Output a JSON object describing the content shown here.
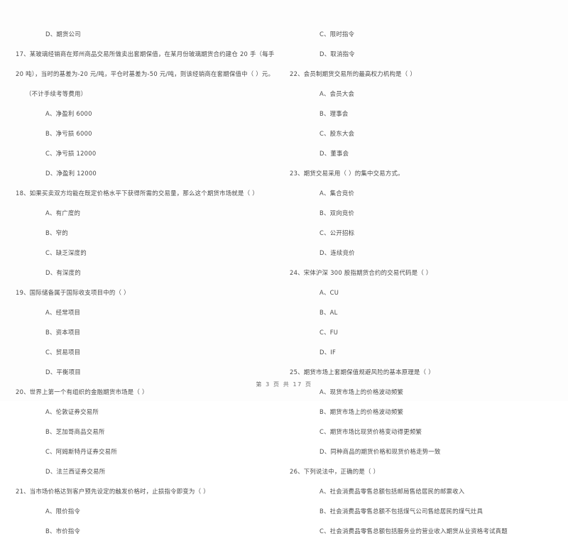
{
  "document": {
    "type": "exam-paper",
    "footer": "第 3 页  共 17 页"
  },
  "left_column": {
    "blocks": [
      {
        "kind": "option",
        "text": "D、期货公司"
      },
      {
        "kind": "question",
        "text": "17、某玻璃经销商在郑州商品交易所做卖出套期保值，在某月份玻璃期货合约建仓 20 手（每手"
      },
      {
        "kind": "question_cont",
        "text": "20 吨），当时的基差为-20 元/吨，平仓时基差为-50 元/吨，则该经销商在套期保值中（      ）元。"
      },
      {
        "kind": "question_cont2",
        "text": "（不计手续考等费用）"
      },
      {
        "kind": "option",
        "text": "A、净盈利 6000"
      },
      {
        "kind": "option",
        "text": "B、净亏损 6000"
      },
      {
        "kind": "option",
        "text": "C、净亏损 12000"
      },
      {
        "kind": "option",
        "text": "D、净盈利 12000"
      },
      {
        "kind": "question",
        "text": "18、如果买卖双方均能在既定价格水平下获得所需的交易量，那么这个期货市场就是（      ）"
      },
      {
        "kind": "option",
        "text": "A、有广度的"
      },
      {
        "kind": "option",
        "text": "B、窄的"
      },
      {
        "kind": "option",
        "text": "C、缺乏深度的"
      },
      {
        "kind": "option",
        "text": "D、有深度的"
      },
      {
        "kind": "question",
        "text": "19、国际储备属于国际收支项目中的（      ）"
      },
      {
        "kind": "option",
        "text": "A、经常项目"
      },
      {
        "kind": "option",
        "text": "B、资本项目"
      },
      {
        "kind": "option",
        "text": "C、贸易项目"
      },
      {
        "kind": "option",
        "text": "D、平衡项目"
      },
      {
        "kind": "question",
        "text": "20、世界上第一个有组织的金融期货市场是（      ）"
      },
      {
        "kind": "option",
        "text": "A、伦敦证券交易所"
      },
      {
        "kind": "option",
        "text": "B、芝加哥商品交易所"
      },
      {
        "kind": "option",
        "text": "C、阿姆斯特丹证券交易所"
      },
      {
        "kind": "option",
        "text": "D、法兰西证券交易所"
      },
      {
        "kind": "question",
        "text": "21、当市场价格达到客户预先设定的触发价格时，止损指令即变为（      ）"
      },
      {
        "kind": "option",
        "text": "A、限价指令"
      },
      {
        "kind": "option",
        "text": "B、市价指令"
      }
    ]
  },
  "right_column": {
    "blocks": [
      {
        "kind": "option",
        "text": "C、限时指令"
      },
      {
        "kind": "option",
        "text": "D、取消指令"
      },
      {
        "kind": "question",
        "text": "22、会员制期货交易所的最高权力机构是（      ）"
      },
      {
        "kind": "option",
        "text": "A、会员大会"
      },
      {
        "kind": "option",
        "text": "B、理事会"
      },
      {
        "kind": "option",
        "text": "C、股东大会"
      },
      {
        "kind": "option",
        "text": "D、董事会"
      },
      {
        "kind": "question",
        "text": "23、期货交易采用（      ）的集中交易方式。"
      },
      {
        "kind": "option",
        "text": "A、集合竞价"
      },
      {
        "kind": "option",
        "text": "B、双向竞价"
      },
      {
        "kind": "option",
        "text": "C、公开招标"
      },
      {
        "kind": "option",
        "text": "D、连续竞价"
      },
      {
        "kind": "question",
        "text": "24、宋体沪深 300 股指期货合约的交易代码是（      ）"
      },
      {
        "kind": "option",
        "text": "A、CU"
      },
      {
        "kind": "option",
        "text": "B、AL"
      },
      {
        "kind": "option",
        "text": "C、FU"
      },
      {
        "kind": "option",
        "text": "D、IF"
      },
      {
        "kind": "question",
        "text": "25、期货市场上套期保值规避风险的基本原理是（      ）"
      },
      {
        "kind": "option",
        "text": "A、现货市场上的价格波动频繁"
      },
      {
        "kind": "option",
        "text": "B、期货市场上的价格波动频繁"
      },
      {
        "kind": "option",
        "text": "C、期货市场比现货价格变动得更频繁"
      },
      {
        "kind": "option",
        "text": "D、同种商品的期货价格和现货价格走势一致"
      },
      {
        "kind": "question",
        "text": "26、下列说法中，正确的是（      ）"
      },
      {
        "kind": "option",
        "text": "A、社会消费品零售总额包括邮局售给居民的邮票收入"
      },
      {
        "kind": "option",
        "text": "B、社会消费品零售总额不包括煤气公司售给居民的煤气灶具"
      },
      {
        "kind": "option",
        "text": "C、社会消费品零售总额包括服务业的营业收入期货从业资格考试真题"
      }
    ]
  }
}
